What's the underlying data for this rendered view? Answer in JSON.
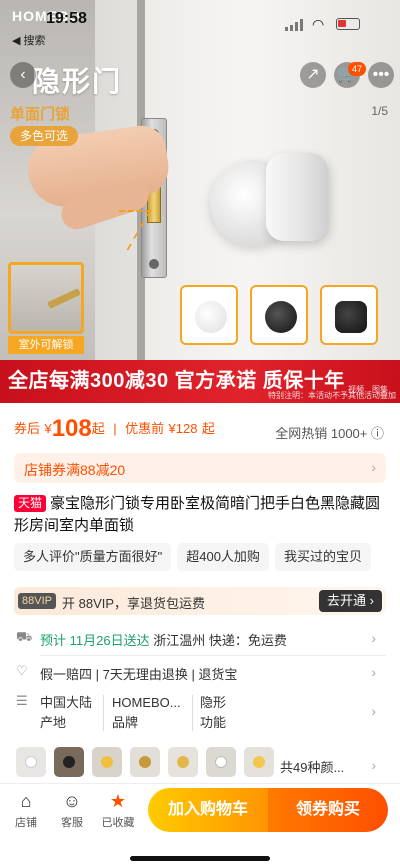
{
  "status_bar": {
    "brand_overlay": "HOMEBO",
    "time": "19:58",
    "back_label": "◀ 搜索"
  },
  "hero": {
    "title": "隐形门",
    "subtitle": "单面门锁",
    "pill": "多色可选",
    "image_counter": "1/5",
    "inset_label": "室外可解锁",
    "cart_badge": "47",
    "promo_banner": "全店每满300减30 官方承诺 质保十年",
    "promo_video": "视频",
    "promo_atlas": "图集",
    "promo_note": "特别注明：本活动不予其他活动叠加"
  },
  "price": {
    "label": "券后",
    "currency": "¥",
    "amount": "108",
    "qi": "起",
    "sep": "|",
    "before_label": "优惠前",
    "before_amount": "¥128",
    "before_qi": "起",
    "sales": "全网热销 1000+ ⓘ"
  },
  "coupon": {
    "text": "店铺券满88减20"
  },
  "product": {
    "tmall_badge": "天猫",
    "title": "豪宝隐形门锁专用卧室极简暗门把手白色黑隐藏圆形房间室内单面锁"
  },
  "tags": [
    "多人评价\"质量方面很好\"",
    "超400人加购",
    "我买过的宝贝"
  ],
  "vip": {
    "badge": "88VIP",
    "text": "开 88VIP，享退货包运费",
    "button": "去开通 ›"
  },
  "shipping": {
    "prefix": "预计",
    "date": "11月26日送达",
    "rest": "浙江温州  快递：免运费"
  },
  "services": {
    "text": "假一赔四 | 7天无理由退换 | 退货宝"
  },
  "attributes": [
    {
      "value": "中国大陆",
      "name": "产地"
    },
    {
      "value": "HOMEBO...",
      "name": "品牌"
    },
    {
      "value": "隐形",
      "name": "功能"
    }
  ],
  "variants": {
    "more": "共49种颜..."
  },
  "bottom_bar": {
    "store": "店铺",
    "service": "客服",
    "favorite": "已收藏",
    "add_cart": "加入购物车",
    "buy": "领券购买"
  },
  "colors": {
    "accent": "#ff5000",
    "tmall": "#ff0036",
    "promo_red": "#e0232b",
    "gold": "#f5a623"
  }
}
